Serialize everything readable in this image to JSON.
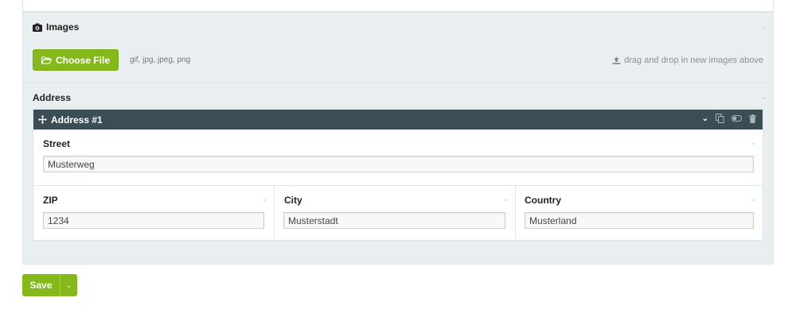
{
  "images": {
    "title": "Images",
    "choose_label": "Choose File",
    "file_types": "gif, jpg, jpeg, png",
    "drop_hint": "drag and drop in new images above"
  },
  "address": {
    "title": "Address",
    "item_title": "Address #1",
    "fields": {
      "street": {
        "label": "Street",
        "value": "Musterweg"
      },
      "zip": {
        "label": "ZIP",
        "value": "1234"
      },
      "city": {
        "label": "City",
        "value": "Musterstadt"
      },
      "country": {
        "label": "Country",
        "value": "Musterland"
      }
    }
  },
  "actions": {
    "save_label": "Save"
  },
  "colors": {
    "accent": "#85b81b",
    "bar": "#3b4e55",
    "panel": "#e9eef1"
  }
}
